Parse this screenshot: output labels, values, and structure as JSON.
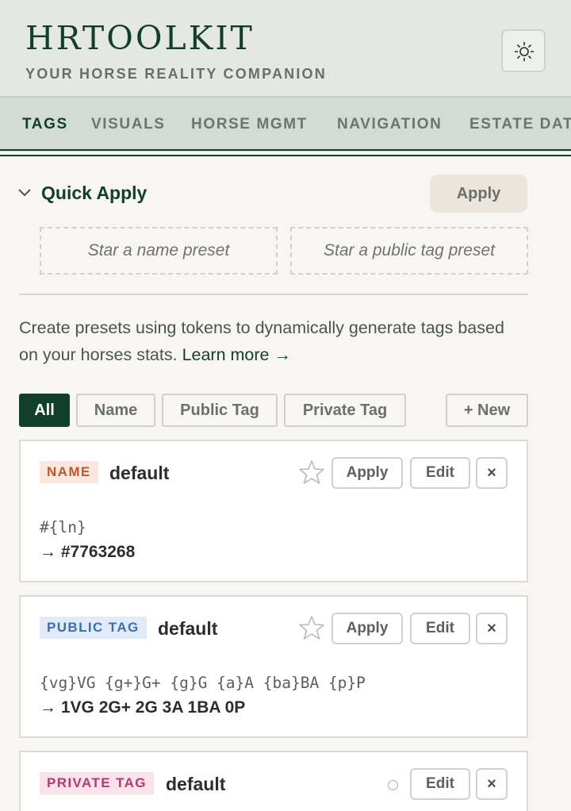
{
  "header": {
    "brand": "HRTOOLKIT",
    "tagline": "YOUR HORSE REALITY COMPANION",
    "theme_icon": "sun-icon"
  },
  "nav": {
    "tabs": [
      {
        "label": "TAGS",
        "active": true
      },
      {
        "label": "VISUALS",
        "active": false
      },
      {
        "label": "HORSE MGMT",
        "active": false
      },
      {
        "label": "NAVIGATION",
        "active": false
      },
      {
        "label": "ESTATE DATA",
        "active": false
      }
    ]
  },
  "quick_apply": {
    "title": "Quick Apply",
    "apply_label": "Apply",
    "name_slot": "Star a name preset",
    "public_slot": "Star a public tag preset"
  },
  "description": {
    "text": "Create presets using tokens to dynamically generate tags based on your horses stats.",
    "learn_more": "Learn more →"
  },
  "filters": {
    "items": [
      "All",
      "Name",
      "Public Tag",
      "Private Tag"
    ],
    "active": "All",
    "new_label": "+ New"
  },
  "presets": [
    {
      "kind": "NAME",
      "title": "default",
      "template": "#{ln}",
      "result": "→ #7763268",
      "starred": false,
      "apply_label": "Apply",
      "edit_label": "Edit",
      "delete_label": "×"
    },
    {
      "kind": "PUBLIC TAG",
      "title": "default",
      "template": "{vg}VG {g+}G+ {g}G {a}A {ba}BA {p}P",
      "result": "→ 1VG 2G+ 2G 3A 1BA 0P",
      "starred": false,
      "apply_label": "Apply",
      "edit_label": "Edit",
      "delete_label": "×"
    },
    {
      "kind": "PRIVATE TAG",
      "title": "default",
      "edit_label": "Edit",
      "delete_label": "×"
    }
  ],
  "colors": {
    "brand_green": "#123f2b",
    "name_badge": "#c2562d",
    "public_badge": "#3c6fb0",
    "private_badge": "#b03c70"
  }
}
